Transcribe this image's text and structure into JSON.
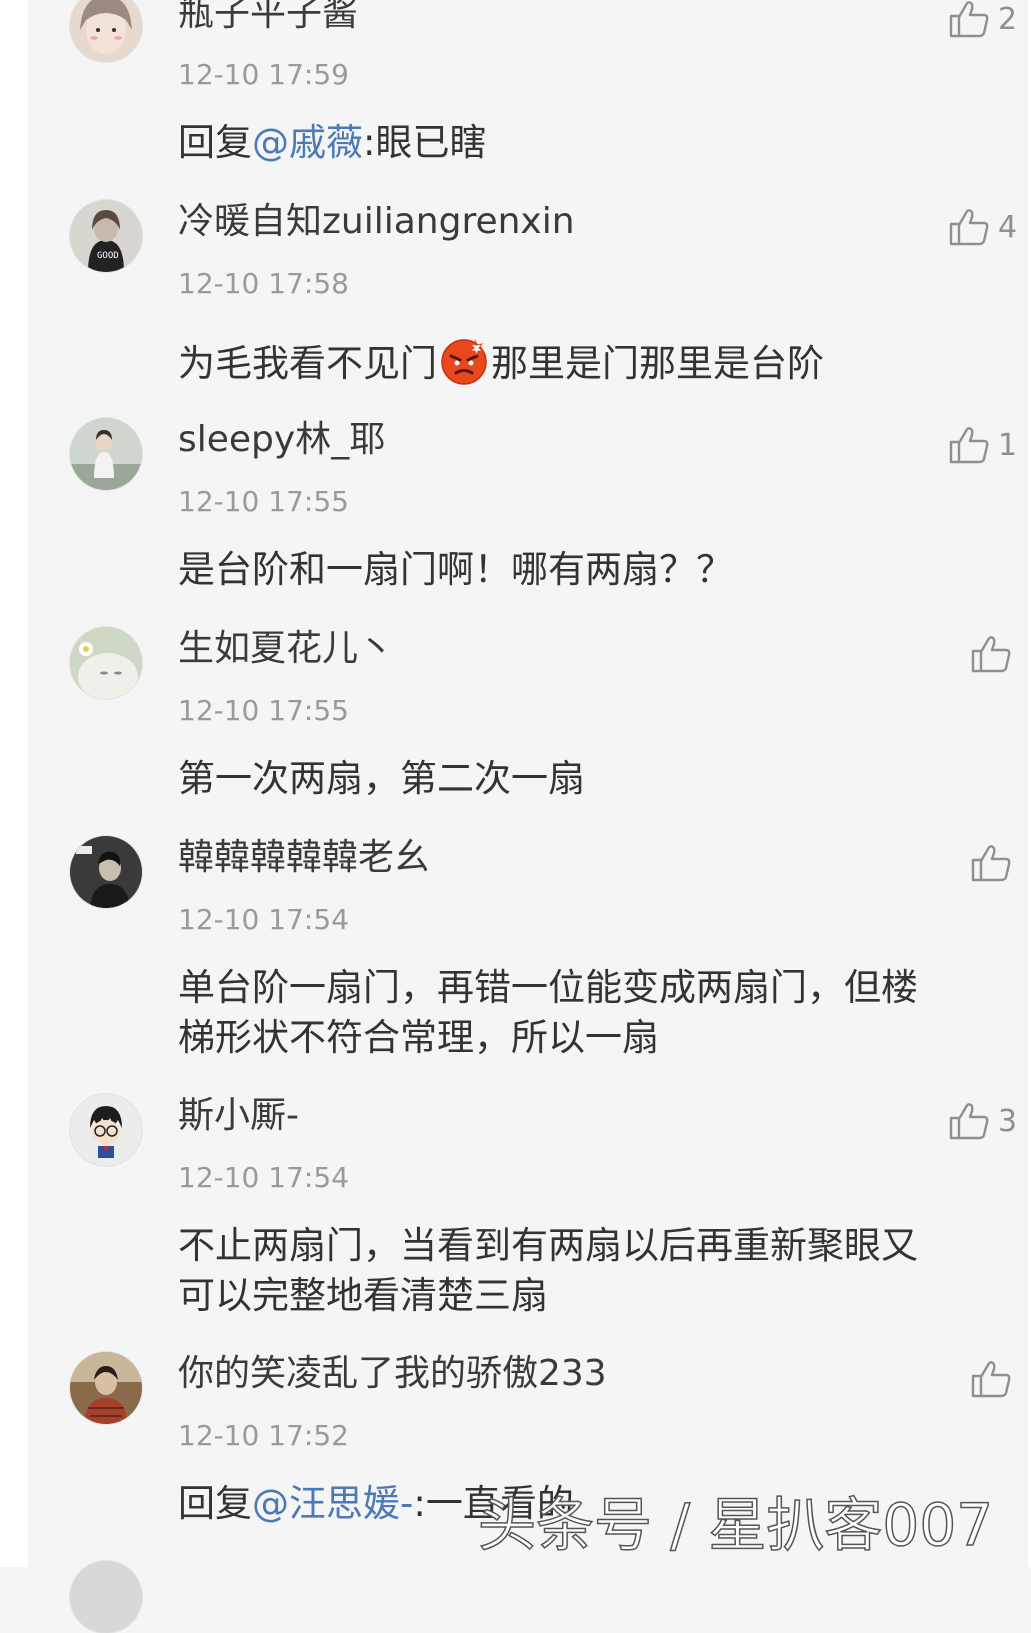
{
  "comments": [
    {
      "name": "瓶子平子酱",
      "time": "12-10 17:59",
      "likes": "2",
      "reply_prefix": "回复",
      "mention": "@戚薇",
      "text": ":眼已瞎"
    },
    {
      "name": "冷暖自知zuiliangrenxin",
      "time": "12-10 17:58",
      "likes": "4",
      "text_before": "为毛我看不见门",
      "emoji": "angry-face-emoji",
      "text_after": "那里是门那里是台阶"
    },
    {
      "name": "sleepy林_耶",
      "time": "12-10 17:55",
      "likes": "1",
      "text": "是台阶和一扇门啊！哪有两扇？？"
    },
    {
      "name": "生如夏花儿丶",
      "time": "12-10 17:55",
      "likes": "",
      "text": "第一次两扇，第二次一扇"
    },
    {
      "name": "韓韓韓韓韓老幺",
      "time": "12-10 17:54",
      "likes": "",
      "text_line1": "单台阶一扇门，再错一位能变成两扇门，但楼",
      "text_line2": "梯形状不符合常理，所以一扇"
    },
    {
      "name": "斯小厮-",
      "time": "12-10 17:54",
      "likes": "3",
      "text_line1": "不止两扇门，当看到有两扇以后再重新聚眼又",
      "text_line2": "可以完整地看清楚三扇"
    },
    {
      "name": "你的笑凌乱了我的骄傲233",
      "time": "12-10 17:52",
      "likes": "",
      "reply_prefix": "回复",
      "mention": "@汪思媛-",
      "text": ":一直看的"
    }
  ],
  "watermark": "头条号 / 星扒客007",
  "icons": {
    "like": "thumbs-up-icon"
  },
  "colors": {
    "background": "#f5f5f5",
    "mention": "#4a7ab8",
    "name": "#3a3a3a",
    "time": "#9a9a9a"
  }
}
